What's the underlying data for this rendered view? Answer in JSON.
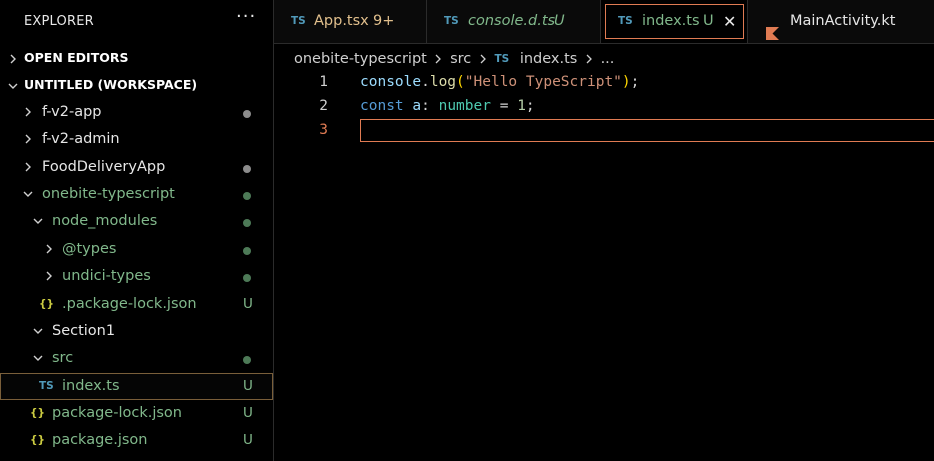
{
  "sidebar": {
    "title": "EXPLORER",
    "more": "···",
    "open_editors": "OPEN EDITORS",
    "workspace": "UNTITLED (WORKSPACE)",
    "items": [
      {
        "label": "f-v2-app",
        "status": "dot"
      },
      {
        "label": "f-v2-admin",
        "status": ""
      },
      {
        "label": "FoodDeliveryApp",
        "status": "dot"
      },
      {
        "label": "onebite-typescript",
        "status": "dot"
      },
      {
        "label": "node_modules",
        "status": "dot"
      },
      {
        "label": "@types",
        "status": "dot"
      },
      {
        "label": "undici-types",
        "status": "dot"
      },
      {
        "label": ".package-lock.json",
        "icon": "{}",
        "status": "U"
      },
      {
        "label": "Section1",
        "status": ""
      },
      {
        "label": "src",
        "status": "dot"
      },
      {
        "label": "index.ts",
        "icon": "TS",
        "status": "U"
      },
      {
        "label": "package-lock.json",
        "icon": "{}",
        "status": "U"
      },
      {
        "label": "package.json",
        "icon": "{}",
        "status": "U"
      }
    ]
  },
  "tabs": [
    {
      "icon": "TS",
      "label": "App.tsx",
      "badge": "9+"
    },
    {
      "icon": "TS",
      "label": "console.d.ts",
      "badge": "U"
    },
    {
      "icon": "TS",
      "label": "index.ts",
      "badge": "U",
      "close": "✕"
    },
    {
      "icon": "kotlin-icon",
      "label": "MainActivity.kt"
    }
  ],
  "breadcrumb": {
    "folder": "onebite-typescript",
    "sub": "src",
    "icon": "TS",
    "file": "index.ts",
    "more": "..."
  },
  "editor": {
    "line_numbers": [
      "1",
      "2",
      "3"
    ],
    "line1": {
      "obj": "console",
      "dot": ".",
      "fn": "log",
      "open": "(",
      "str": "\"Hello TypeScript\"",
      "close": ")",
      "semi": ";"
    },
    "line2": {
      "kw": "const",
      "var": "a",
      "colon": ":",
      "type": "number",
      "eq": "=",
      "num": "1",
      "semi": ";"
    }
  },
  "colors": {
    "untracked": "#81b88b",
    "modified_badge": "#e2c08d",
    "accent": "#e07b53",
    "ts_icon": "#519aba",
    "json_icon": "#cbcb41"
  }
}
